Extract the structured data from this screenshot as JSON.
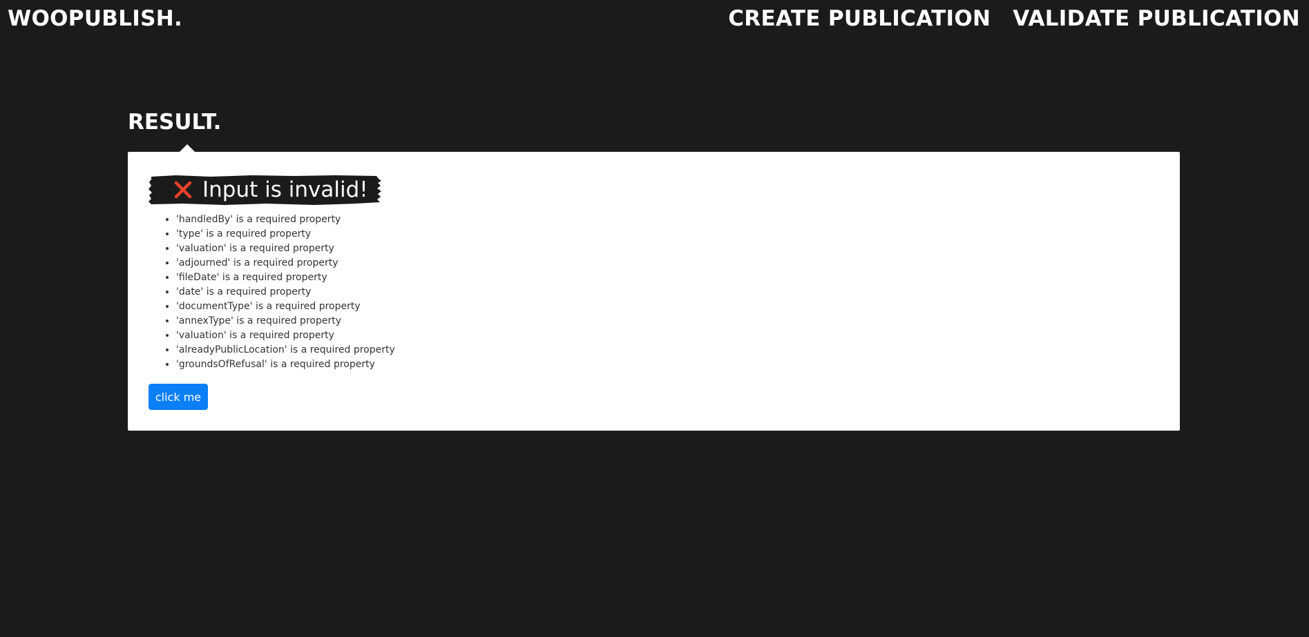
{
  "header": {
    "logo": "WOOPUBLISH.",
    "nav": [
      "CREATE PUBLICATION",
      "VALIDATE PUBLICATION"
    ]
  },
  "result": {
    "title": "RESULT.",
    "status_icon": "cross-mark-icon",
    "status_message": "Input is invalid!",
    "errors": [
      "'handledBy' is a required property",
      "'type' is a required property",
      "'valuation' is a required property",
      "'adjourned' is a required property",
      "'fileDate' is a required property",
      "'date' is a required property",
      "'documentType' is a required property",
      "'annexType' is a required property",
      "'valuation' is a required property",
      "'alreadyPublicLocation' is a required property",
      "'groundsOfRefusal' is a required property"
    ],
    "button_label": "click me"
  },
  "colors": {
    "background": "#1b1b1b",
    "card": "#ffffff",
    "button": "#0a7ff7",
    "error_icon": "#e8412a"
  }
}
